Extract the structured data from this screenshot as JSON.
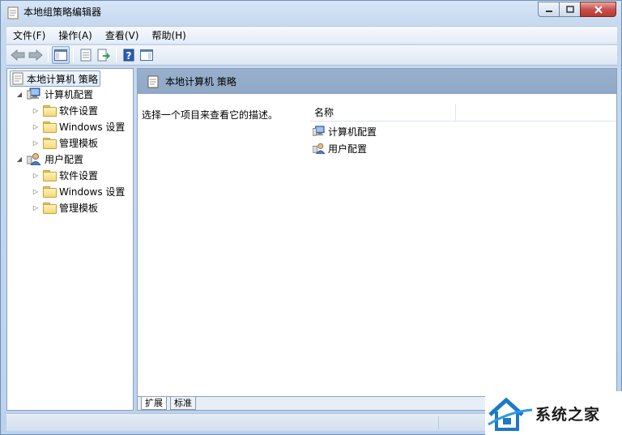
{
  "window": {
    "title": "本地组策略编辑器"
  },
  "menu": [
    "文件(F)",
    "操作(A)",
    "查看(V)",
    "帮助(H)"
  ],
  "toolbar": {
    "buttons": [
      "back-icon",
      "forward-icon",
      "show-hide-tree-icon",
      "properties-icon",
      "export-list-icon",
      "help-icon",
      "show-action-pane-icon"
    ]
  },
  "tree": {
    "root": "本地计算机 策略",
    "computer": "计算机配置",
    "user": "用户配置",
    "children": [
      "软件设置",
      "Windows 设置",
      "管理模板"
    ]
  },
  "rightpane": {
    "header": "本地计算机 策略",
    "description": "选择一个项目来查看它的描述。",
    "column_name": "名称",
    "items": [
      "计算机配置",
      "用户配置"
    ]
  },
  "tabs": [
    "扩展",
    "标准"
  ],
  "watermark": "系统之家",
  "colors": {
    "header_bg": "#8fa8c6",
    "frame": "#c6d9ef"
  }
}
